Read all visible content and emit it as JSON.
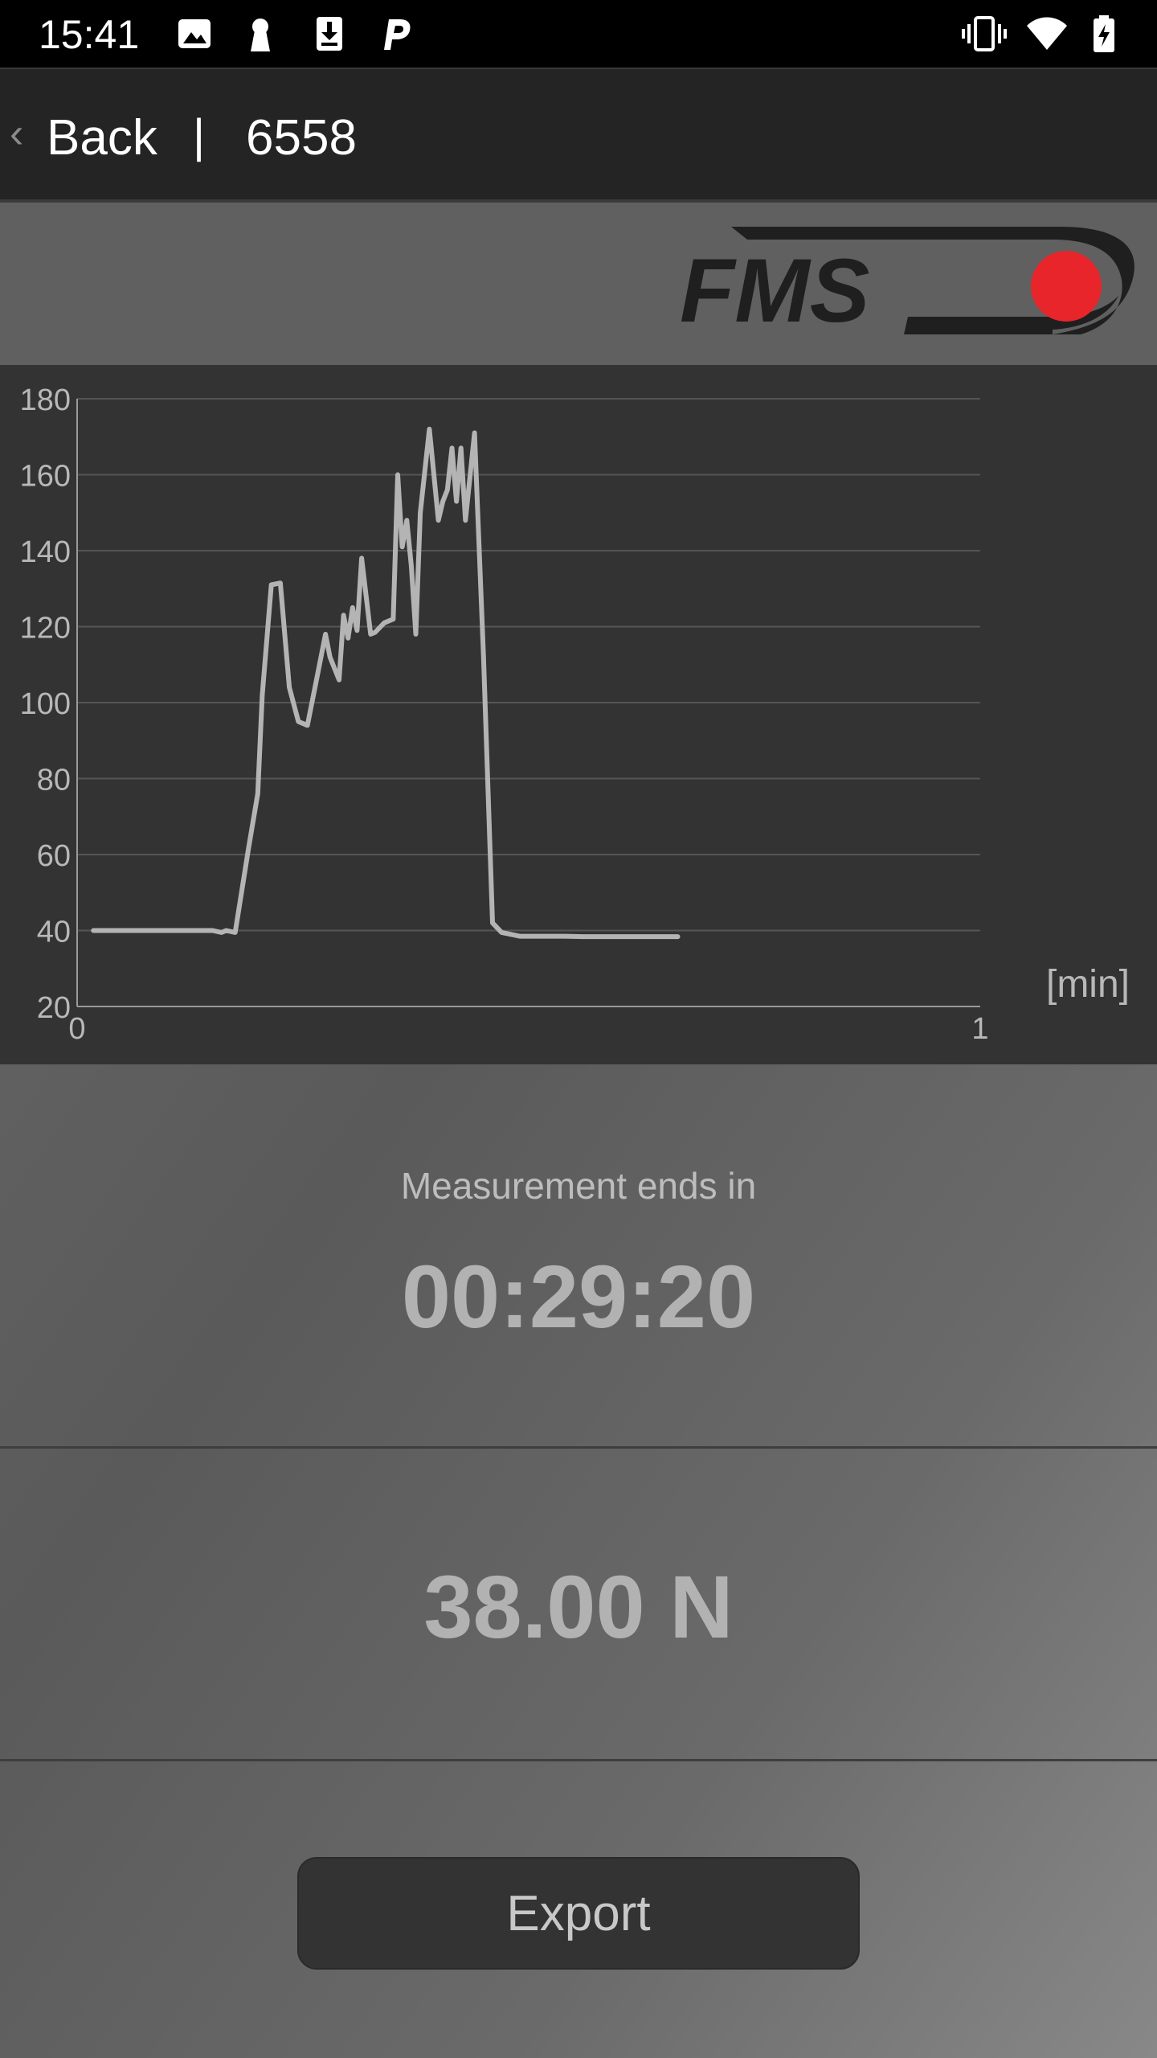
{
  "status_bar": {
    "time": "15:41",
    "left_icons": [
      "image-icon",
      "keyhole-icon",
      "download-icon",
      "p-app-icon"
    ],
    "right_icons": [
      "vibrate-icon",
      "wifi-icon",
      "battery-charging-icon"
    ]
  },
  "nav": {
    "back_chevron": "‹",
    "back_label": "Back",
    "separator": "|",
    "title": "6558"
  },
  "logo": {
    "text": "FMS",
    "accent_color": "#e8252a"
  },
  "chart_data": {
    "type": "line",
    "ylim": [
      20,
      180
    ],
    "xlim": [
      0,
      1
    ],
    "y_ticks": [
      "180",
      "160",
      "140",
      "120",
      "100",
      "80",
      "60",
      "40",
      "20"
    ],
    "x_ticks": [
      "0",
      "1"
    ],
    "xlabel": "[min]",
    "ylabel": "",
    "grid": true,
    "line_color": "#b4b4b4",
    "series": [
      {
        "x": [
          0.018,
          0.04,
          0.06,
          0.08,
          0.1,
          0.12,
          0.135,
          0.15,
          0.16,
          0.165,
          0.175,
          0.19,
          0.2,
          0.205,
          0.215,
          0.225,
          0.235,
          0.245,
          0.255,
          0.265,
          0.275,
          0.28,
          0.29,
          0.295,
          0.3,
          0.305,
          0.31,
          0.315,
          0.325,
          0.33,
          0.34,
          0.35,
          0.355,
          0.36,
          0.365,
          0.37,
          0.375,
          0.38,
          0.39,
          0.4,
          0.405,
          0.41,
          0.415,
          0.42,
          0.425,
          0.43,
          0.44,
          0.45,
          0.46,
          0.47,
          0.48,
          0.49,
          0.5,
          0.52,
          0.54,
          0.56,
          0.58,
          0.6,
          0.62,
          0.665
        ],
        "y": [
          40,
          40,
          40,
          40,
          40,
          40,
          40,
          40,
          39.5,
          40,
          39.5,
          62,
          76,
          102,
          131,
          131.5,
          104,
          95,
          94,
          106,
          118,
          112,
          106,
          123,
          117,
          125,
          119,
          138,
          118,
          118.5,
          121,
          122,
          160,
          141,
          148,
          136,
          118,
          150,
          172,
          148,
          153,
          156,
          167,
          153,
          167,
          148,
          171,
          112,
          42,
          39.5,
          39,
          38.5,
          38.5,
          38.5,
          38.5,
          38.4,
          38.4,
          38.4,
          38.4,
          38.4
        ]
      }
    ]
  },
  "measurement": {
    "label": "Measurement ends in",
    "remaining": "00:29:20"
  },
  "reading": {
    "value": "38.00 N"
  },
  "export": {
    "label": "Export"
  }
}
